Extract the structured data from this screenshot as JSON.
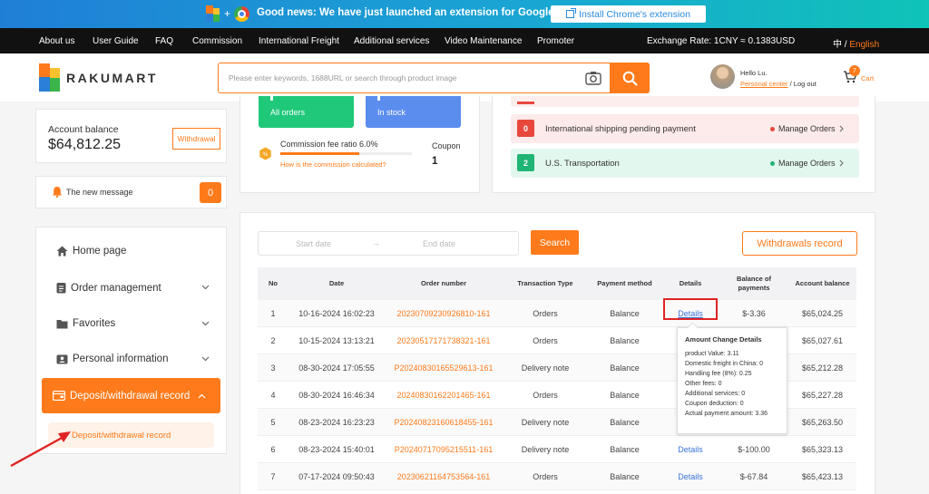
{
  "banner": {
    "news": "Good news: We have just launched an extension for Google Chrome",
    "install_label": "Install Chrome's extension",
    "plus": "+"
  },
  "nav": {
    "items": [
      "About us",
      "User Guide",
      "FAQ",
      "Commission",
      "International Freight",
      "Additional services",
      "Video Maintenance",
      "Promoter"
    ],
    "exchange": "Exchange Rate: 1CNY ≈ 0.1383USD",
    "lang_zh": "中",
    "lang_sep": " / ",
    "lang_en": "English"
  },
  "header": {
    "logo_text": "RAKUMART",
    "search_placeholder": "Please enter keywords, 1688URL or search through product image",
    "hello": "Hello Lu.",
    "personal_center": "Personal center",
    "logout": " / Log out",
    "cart_count": "7",
    "cart_label": "Cart"
  },
  "account": {
    "label": "Account balance",
    "balance": "$64,812.25",
    "withdraw_label": "Withdrawal"
  },
  "message": {
    "label": "The new message",
    "count": "0"
  },
  "sidebar": {
    "home": "Home page",
    "order": "Order management",
    "favorites": "Favorites",
    "personal": "Personal information",
    "active": "Deposit/withdrawal record",
    "sub": "Deposit/withdrawal record"
  },
  "stats": {
    "all_orders": "All orders",
    "in_stock": "In stock",
    "fee_label": "Commission fee ratio 6.0%",
    "fee_progress": 0.6,
    "fee_link": "How is the commission calculated?",
    "coupon_label": "Coupon",
    "coupon_value": "1"
  },
  "statuses": [
    {
      "num": "0",
      "text": "International shipping pending payment",
      "action": "Manage Orders",
      "color": "#e8483c"
    },
    {
      "num": "2",
      "text": "U.S. Transportation",
      "action": "Manage Orders",
      "color": "#20b574"
    }
  ],
  "records": {
    "start_placeholder": "Start date",
    "arrow": "→",
    "end_placeholder": "End date",
    "search_label": "Search",
    "withdrawals_label": "Withdrawals record",
    "headers": [
      "No",
      "Date",
      "Order number",
      "Transaction Type",
      "Payment method",
      "Details",
      "Balance of payments",
      "Account balance"
    ],
    "rows": [
      {
        "no": "1",
        "date": "10-16-2024 16:02:23",
        "order": "20230709230926810-161",
        "type": "Orders",
        "method": "Balance",
        "details": "Details",
        "bop": "$-3.36",
        "balance": "$65,024.25"
      },
      {
        "no": "2",
        "date": "10-15-2024 13:13:21",
        "order": "20230517171738321-161",
        "type": "Orders",
        "method": "Balance",
        "details": "",
        "bop": "",
        "balance": "$65,027.61"
      },
      {
        "no": "3",
        "date": "08-30-2024 17:05:55",
        "order": "P20240830165529613-161",
        "type": "Delivery note",
        "method": "Balance",
        "details": "",
        "bop": "",
        "balance": "$65,212.28"
      },
      {
        "no": "4",
        "date": "08-30-2024 16:46:34",
        "order": "20240830162201465-161",
        "type": "Orders",
        "method": "Balance",
        "details": "",
        "bop": "",
        "balance": "$65,227.28"
      },
      {
        "no": "5",
        "date": "08-23-2024 16:23:23",
        "order": "P20240823160618455-161",
        "type": "Delivery note",
        "method": "Balance",
        "details": "",
        "bop": "",
        "balance": "$65,263.50"
      },
      {
        "no": "6",
        "date": "08-23-2024 15:40:01",
        "order": "P20240717095215511-161",
        "type": "Delivery note",
        "method": "Balance",
        "details": "Details",
        "bop": "$-100.00",
        "balance": "$65,323.13"
      },
      {
        "no": "7",
        "date": "07-17-2024 09:50:43",
        "order": "20230621164753564-161",
        "type": "Orders",
        "method": "Balance",
        "details": "Details",
        "bop": "$-67.84",
        "balance": "$65,423.13"
      }
    ]
  },
  "tooltip": {
    "title": "Amount Change Details",
    "lines": [
      "product Value:  3.11",
      "Domestic freight in China:  0",
      "Handling fee (8%):  0.25",
      "Other fees:  0",
      "Additional services:  0",
      "Coupon deduction:  0",
      "Actual payment amount:  3.36"
    ]
  },
  "colors": {
    "accent": "#ff7a1a",
    "stat_green": "#20c87a",
    "stat_blue": "#5b8def",
    "highlight": "#e02424"
  }
}
